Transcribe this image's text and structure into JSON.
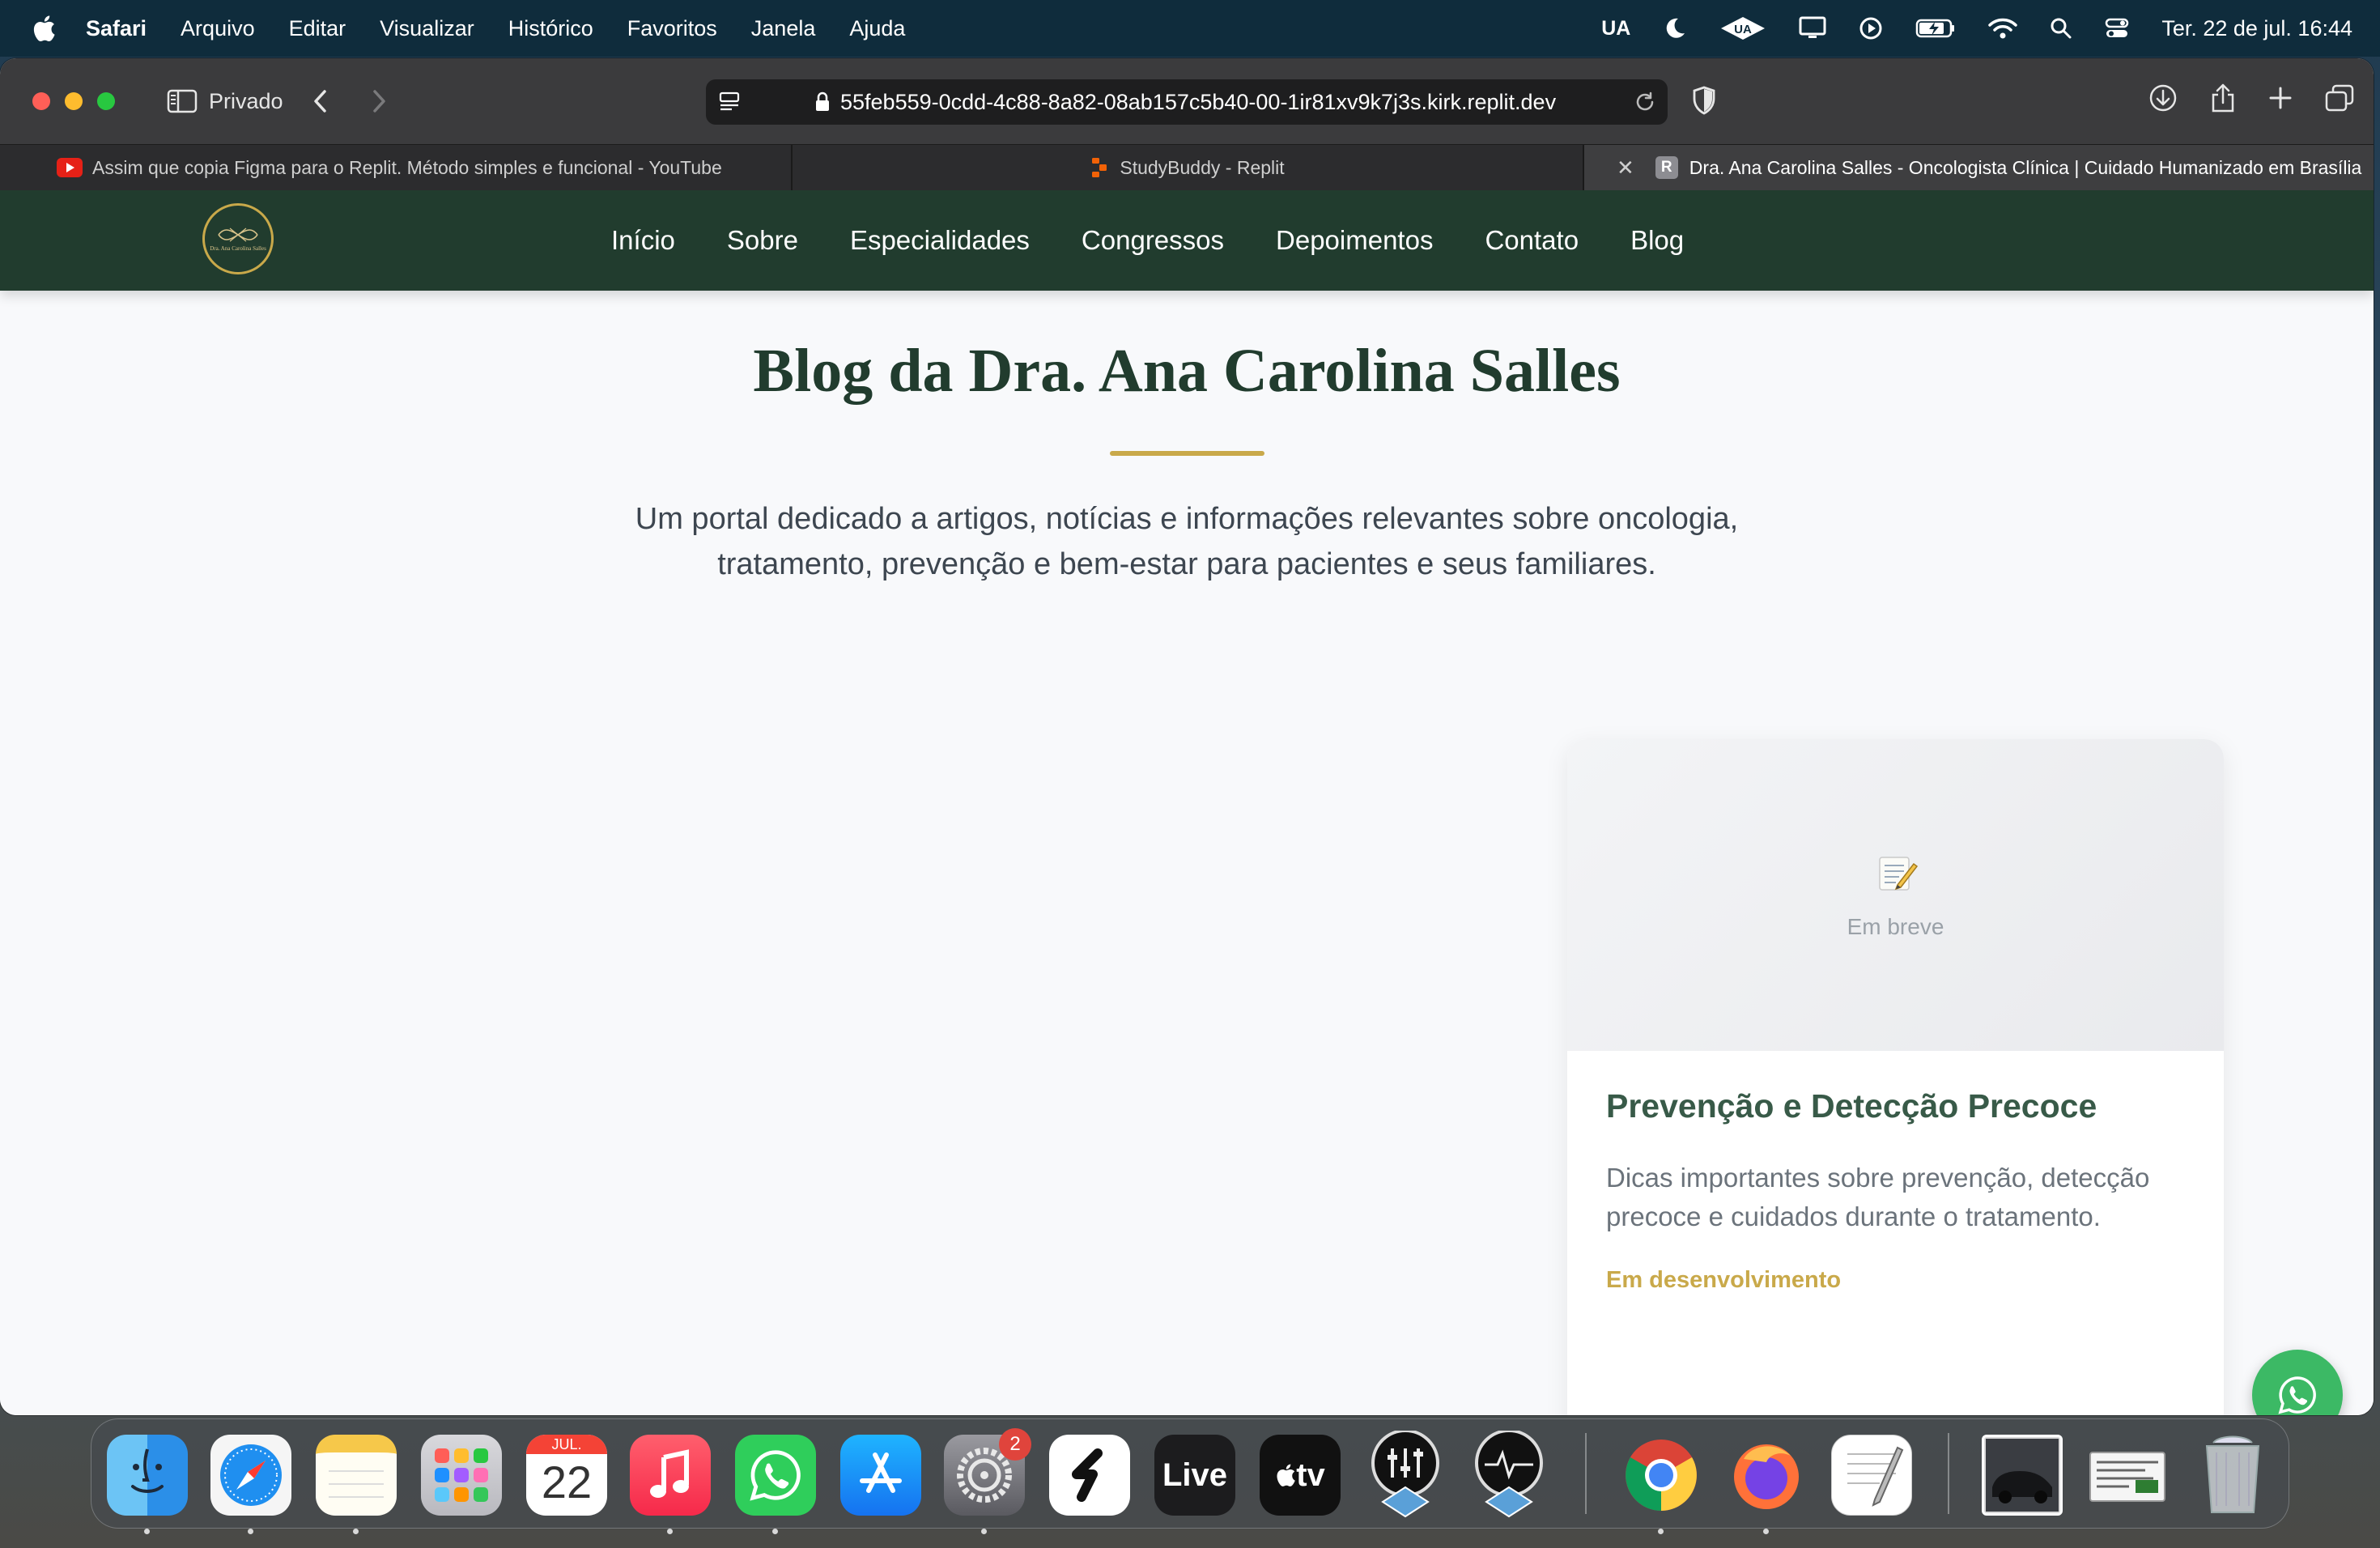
{
  "menubar": {
    "app_name": "Safari",
    "items": [
      "Arquivo",
      "Editar",
      "Visualizar",
      "Histórico",
      "Favoritos",
      "Janela",
      "Ajuda"
    ],
    "status_ua": "UA",
    "datetime": "Ter. 22 de jul.  16:44"
  },
  "safari": {
    "sidebar_label": "Privado",
    "url": "55feb559-0cdd-4c88-8a82-08ab157c5b40-00-1ir81xv9k7j3s.kirk.replit.dev",
    "tabs": [
      {
        "title": "Assim que copia Figma para o Replit. Método simples e funcional - YouTube",
        "icon": "youtube-icon"
      },
      {
        "title": "StudyBuddy - Replit",
        "icon": "replit-icon"
      },
      {
        "title": "Dra. Ana Carolina Salles - Oncologista Clínica | Cuidado Humanizado em Brasília",
        "icon": "R",
        "active": true
      }
    ]
  },
  "site": {
    "logo_text": "Dra. Ana Carolina Salles",
    "nav": [
      "Início",
      "Sobre",
      "Especialidades",
      "Congressos",
      "Depoimentos",
      "Contato",
      "Blog"
    ],
    "hero_title": "Blog da Dra. Ana Carolina Salles",
    "hero_subtitle_line1": "Um portal dedicado a artigos, notícias e informações relevantes sobre oncologia,",
    "hero_subtitle_line2": "tratamento, prevenção e bem-estar para pacientes e seus familiares.",
    "card": {
      "media_icon": "memo-icon",
      "media_label": "Em breve",
      "title": "Prevenção e Detecção Precoce",
      "description": "Dicas importantes sobre prevenção, detecção precoce e cuidados durante o tratamento.",
      "status": "Em desenvolvimento"
    }
  },
  "dock": {
    "calendar_month": "JUL.",
    "calendar_day": "22",
    "settings_badge": "2",
    "live_label": "Live",
    "tv_label": "tv",
    "apps": [
      "Finder",
      "Safari",
      "Notes",
      "Launchpad",
      "Calendar",
      "Music",
      "WhatsApp",
      "App Store",
      "System Settings",
      "Setapp",
      "Ableton Live",
      "Apple TV",
      "UAD Console",
      "UA Connect",
      "Chrome",
      "Firefox",
      "TextEdit",
      "Image",
      "Document",
      "Trash"
    ]
  },
  "colors": {
    "nav_bg": "#213c2e",
    "accent_gold": "#c9a94a",
    "title_green": "#213c2e",
    "whatsapp_green": "#3cb965"
  }
}
